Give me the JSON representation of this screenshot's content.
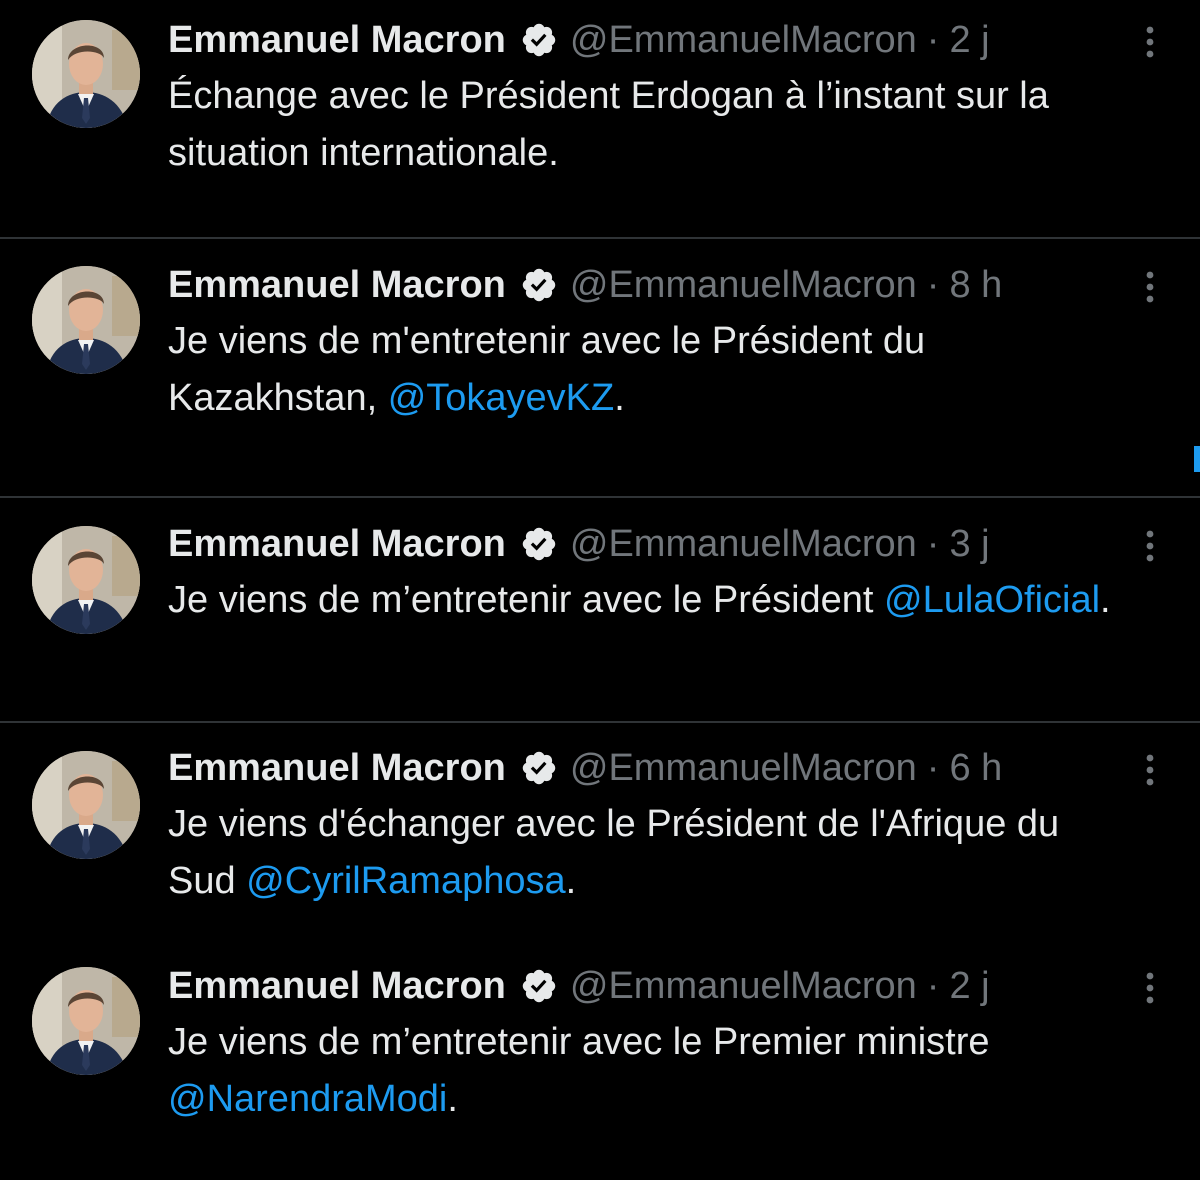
{
  "colors": {
    "background": "#000000",
    "text": "#e7e9ea",
    "secondary": "#71767b",
    "mention": "#1d9bf0",
    "verified": "#e7e9ea",
    "divider": "#2f3336"
  },
  "icons": {
    "verified": "verified-badge-icon",
    "more": "more-options-icon"
  },
  "tweets": [
    {
      "author": "Emmanuel Macron",
      "handle": "@EmmanuelMacron",
      "separator": "·",
      "time": "2 j",
      "text": "Échange avec le Président Erdogan à l’instant sur la situation internationale."
    },
    {
      "author": "Emmanuel Macron",
      "handle": "@EmmanuelMacron",
      "separator": "·",
      "time": "8 h",
      "text_before": "Je viens de m'entretenir avec le Président du Kazakhstan, ",
      "mention": "@TokayevKZ",
      "text_after": "."
    },
    {
      "author": "Emmanuel Macron",
      "handle": "@EmmanuelMacron",
      "separator": "·",
      "time": "3 j",
      "text_before": "Je viens de m’entretenir avec le Président ",
      "mention": "@LulaOficial",
      "text_after": "."
    },
    {
      "author": "Emmanuel Macron",
      "handle": "@EmmanuelMacron",
      "separator": "·",
      "time": "6 h",
      "text_before": "Je viens d'échanger avec le Président de l'Afrique du Sud ",
      "mention": "@CyrilRamaphosa",
      "text_after": "."
    },
    {
      "author": "Emmanuel Macron",
      "handle": "@EmmanuelMacron",
      "separator": "·",
      "time": "2 j",
      "text_before": "Je viens de m’entretenir avec le Premier ministre ",
      "mention": "@NarendraModi",
      "text_after": "."
    }
  ]
}
